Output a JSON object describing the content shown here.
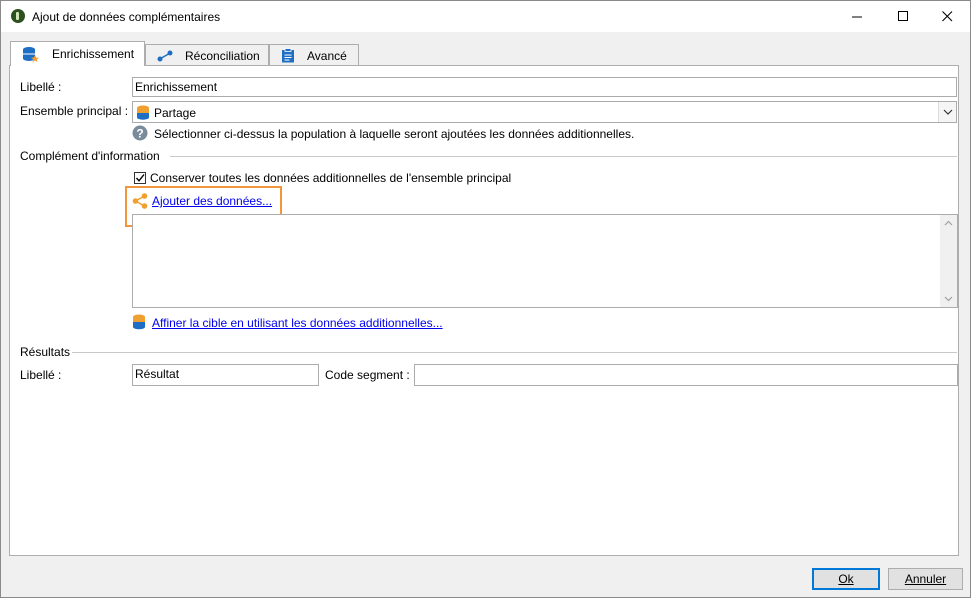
{
  "window": {
    "title": "Ajout de données complémentaires",
    "controls": {
      "minimize": "minimize",
      "maximize": "maximize",
      "close": "close"
    }
  },
  "tabs": [
    {
      "label": "Enrichissement",
      "icon": "database-star-icon",
      "active": true
    },
    {
      "label": "Réconciliation",
      "icon": "link-nodes-icon",
      "active": false
    },
    {
      "label": "Avancé",
      "icon": "clipboard-icon",
      "active": false
    }
  ],
  "form": {
    "libelle_label": "Libellé :",
    "libelle_value": "Enrichissement",
    "ensemble_label": "Ensemble principal :",
    "ensemble_value": "Partage",
    "help_text": "Sélectionner ci-dessus la population à laquelle seront ajoutées les données additionnelles.",
    "complement_section": "Complément d'information",
    "conserver_checkbox_label": "Conserver toutes les données additionnelles de l'ensemble principal",
    "conserver_checked": true,
    "ajouter_link": "Ajouter des données...",
    "affiner_link": "Affiner la cible en utilisant les données additionnelles...",
    "resultats_section": "Résultats",
    "result_libelle_label": "Libellé :",
    "result_libelle_value": "Résultat",
    "code_segment_label": "Code segment :",
    "code_segment_value": ""
  },
  "buttons": {
    "ok": "Ok",
    "annuler": "Annuler"
  },
  "colors": {
    "highlight": "#f0963c",
    "link": "#0000ee",
    "icon_orange": "#f0a030",
    "icon_blue": "#1e6fc4"
  }
}
